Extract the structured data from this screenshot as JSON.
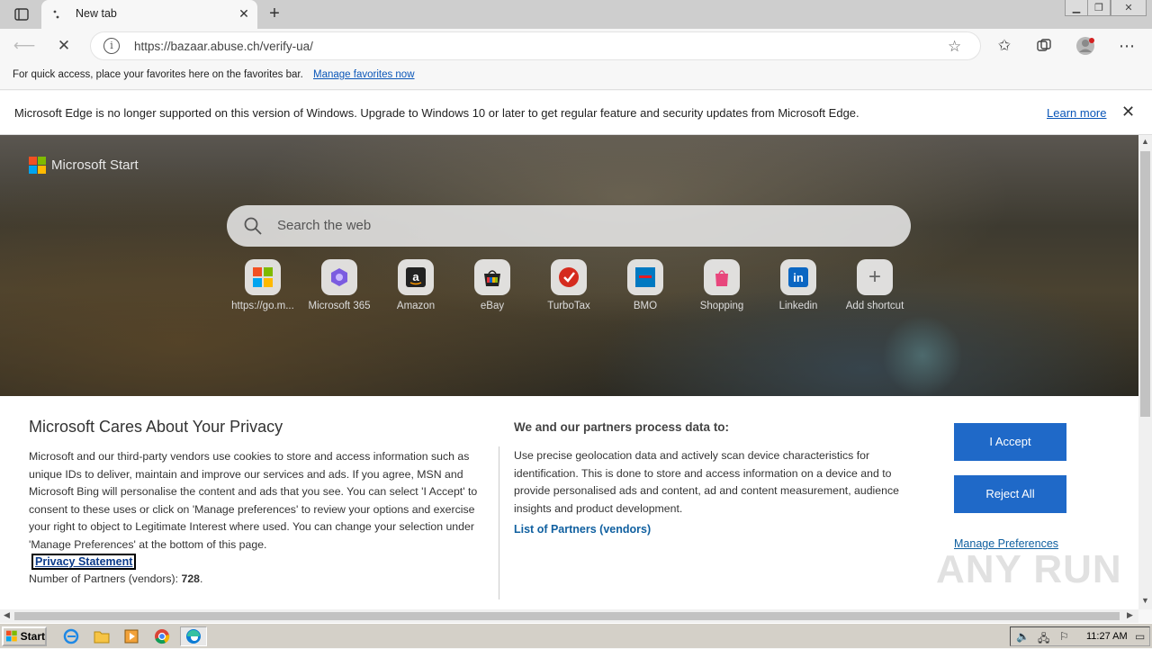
{
  "browser": {
    "tab_title": "New tab",
    "url": "https://bazaar.abuse.ch/verify-ua/",
    "favorites_bar_text": "For quick access, place your favorites here on the favorites bar.",
    "favorites_bar_link": "Manage favorites now",
    "infobar_message": "Microsoft Edge is no longer supported on this version of Windows. Upgrade to Windows 10 or later to get regular feature and security updates from Microsoft Edge.",
    "infobar_link": "Learn more"
  },
  "newtab": {
    "brand": "Microsoft Start",
    "search_placeholder": "Search the web",
    "shortcuts": [
      {
        "label": "https://go.m...",
        "icon": "microsoft-icon"
      },
      {
        "label": "Microsoft 365",
        "icon": "m365-icon"
      },
      {
        "label": "Amazon",
        "icon": "amazon-icon"
      },
      {
        "label": "eBay",
        "icon": "ebay-icon"
      },
      {
        "label": "TurboTax",
        "icon": "turbotax-icon"
      },
      {
        "label": "BMO",
        "icon": "bmo-icon"
      },
      {
        "label": "Shopping",
        "icon": "shopping-icon"
      },
      {
        "label": "Linkedin",
        "icon": "linkedin-icon"
      },
      {
        "label": "Add shortcut",
        "icon": "plus-icon"
      }
    ]
  },
  "privacy": {
    "title": "Microsoft Cares About Your Privacy",
    "body": "Microsoft and our third-party vendors use cookies to store and access information such as unique IDs to deliver, maintain and improve our services and ads. If you agree, MSN and Microsoft Bing will personalise the content and ads that you see. You can select 'I Accept' to consent to these uses or click on 'Manage preferences' to review your options and exercise your right to object to Legitimate Interest where used.  You can change your selection under 'Manage Preferences' at the bottom of this page.",
    "privacy_link": "Privacy Statement",
    "partners_label": "Number of Partners (vendors):",
    "partners_count": "728",
    "partners_suffix": ".",
    "heading2": "We and our partners process data to:",
    "body2": "Use precise geolocation data and actively scan device characteristics for identification. This is done to store and access information on a device and to provide personalised ads and content, ad and content measurement, audience insights and product development.",
    "list_link": "List of Partners (vendors)",
    "accept": "I Accept",
    "reject": "Reject All",
    "manage": "Manage Preferences"
  },
  "watermark": "ANY RUN",
  "taskbar": {
    "start": "Start",
    "time": "11:27 AM"
  },
  "colors": {
    "accent": "#1f69c8",
    "link": "#0a56b8"
  }
}
